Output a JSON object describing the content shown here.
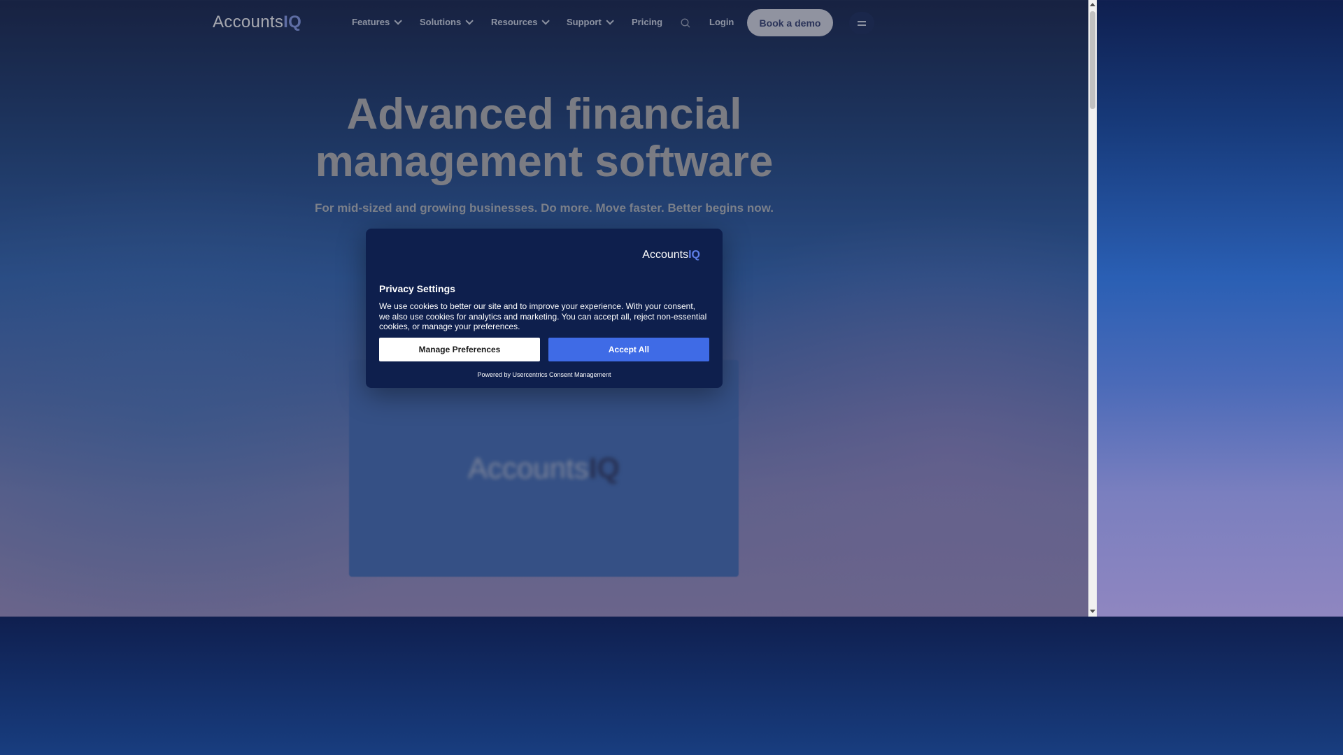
{
  "header": {
    "logo_text": "Accounts",
    "logo_iq": "IQ",
    "nav": [
      {
        "label": "Features",
        "has_dropdown": true
      },
      {
        "label": "Solutions",
        "has_dropdown": true
      },
      {
        "label": "Resources",
        "has_dropdown": true
      },
      {
        "label": "Support",
        "has_dropdown": true
      },
      {
        "label": "Pricing",
        "has_dropdown": false
      }
    ],
    "login_label": "Login",
    "demo_label": "Book a demo"
  },
  "hero": {
    "title_line1": "Advanced financial",
    "title_line2": "management software",
    "subtitle": "For mid-sized and growing businesses. Do more. Move faster. Better begins now."
  },
  "video": {
    "logo_text": "Accounts",
    "logo_iq": "IQ"
  },
  "consent": {
    "logo_text": "Accounts",
    "logo_iq": "IQ",
    "title": "Privacy Settings",
    "body": "We use cookies to better our site and to improve your experience. With your consent, we also use cookies for analytics and marketing. You can accept all, reject non-essential cookies, or manage your preferences.",
    "manage_label": "Manage Preferences",
    "accept_label": "Accept All",
    "powered_by": "Powered by Usercentrics Consent Management"
  },
  "colors": {
    "accent": "#3f6be6",
    "modal_bg": "#0e1f4d",
    "brand_iq": "#5e7fe8"
  }
}
